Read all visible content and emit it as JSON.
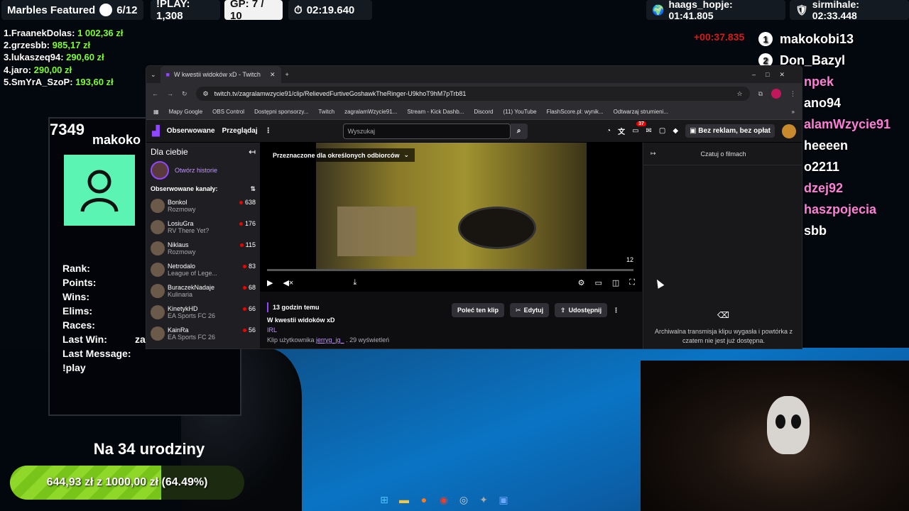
{
  "hud": {
    "marbles": "Marbles Featured",
    "marbles_count": "6/12",
    "play": "!PLAY: 1,308",
    "gp": "GP: 7 / 10",
    "timer": "02:19.640",
    "record1": "haags_hopje: 01:41.805",
    "record2": "sirmihale: 02:33.448",
    "red_timer": "+00:37.835"
  },
  "top_donors": [
    {
      "name": "1.FraanekDolas:",
      "value": "1 002,36 zł"
    },
    {
      "name": "2.grzesbb:",
      "value": "985,17 zł"
    },
    {
      "name": "3.lukaszeq94:",
      "value": "290,60 zł"
    },
    {
      "name": "4.jaro:",
      "value": "290,00 zł"
    },
    {
      "name": "5.SmYrA_SzoP:",
      "value": "193,60 zł"
    }
  ],
  "leaderboard": [
    {
      "rank": "1",
      "name": "makokobi13"
    },
    {
      "rank": "2",
      "name": "Don_Bazyl"
    },
    {
      "rank": "",
      "name": "npek"
    },
    {
      "rank": "",
      "name": "ano94"
    },
    {
      "rank": "",
      "name": "alamWzycie91"
    },
    {
      "rank": "",
      "name": "heeeen"
    },
    {
      "rank": "",
      "name": "o2211"
    },
    {
      "rank": "",
      "name": "dzej92"
    },
    {
      "rank": "",
      "name": "haszpojecia"
    },
    {
      "rank": "",
      "name": "sbb"
    }
  ],
  "panel": {
    "number": "7349",
    "name": "makoko",
    "stats": [
      "Rank:",
      "Points:",
      "Wins:",
      "Elims:",
      "Races:",
      "Last Win:",
      "Last Message:",
      "!play"
    ],
    "last_win_value": "za"
  },
  "goal": {
    "title": "Na 34 urodziny",
    "current": "644,93 zł",
    "sep": "z",
    "target": "1000,00 zł",
    "percent_label": "(64.49%)",
    "fraction": 0.6449
  },
  "browser": {
    "tab_title": "W kwestii widoków xD - Twitch",
    "url": "twitch.tv/zagralamwzycie91/clip/RelievedFurtiveGoshawkTheRinger-U9khoT9hM7pTrb81",
    "bookmarks": [
      "Mapy Google",
      "OBS Control",
      "Dostępni sponsorzy...",
      "Twitch",
      "zagralamWzycie91...",
      "Stream - Kick Dashb...",
      "Discord",
      "(11) YouTube",
      "FlashScore.pl: wynik...",
      "Odtwarzaj strumieni..."
    ]
  },
  "twitch": {
    "nav_following": "Obserwowane",
    "nav_browse": "Przeglądaj",
    "search_placeholder": "Wyszukaj",
    "notif_count": "37",
    "ad_free": "Bez reklam, bez opłat",
    "for_you": "Dla ciebie",
    "open_stories": "Otwórz historie",
    "followed": "Obserwowane kanały:",
    "channels": [
      {
        "name": "Bonkol",
        "game": "Rozmowy",
        "viewers": "638"
      },
      {
        "name": "LosiuGra",
        "game": "RV There Yet?",
        "viewers": "176"
      },
      {
        "name": "Niklaus",
        "game": "Rozmowy",
        "viewers": "115"
      },
      {
        "name": "Netrodalo",
        "game": "League of Lege...",
        "viewers": "83"
      },
      {
        "name": "BuraczekNadaje",
        "game": "Kulinaria",
        "viewers": "68"
      },
      {
        "name": "KinetykHD",
        "game": "EA Sports FC 26",
        "viewers": "66"
      },
      {
        "name": "KainRa",
        "game": "EA Sports FC 26",
        "viewers": "56"
      }
    ],
    "audience_badge": "Przeznaczone dla określonych odbiorców",
    "video_count": "12",
    "time_ago": "13 godzin temu",
    "clip_title": "W kwestii widoków xD",
    "category": "IRL",
    "clip_by": "Klip użytkownika",
    "clip_author": "jerryg_jg_",
    "views": " . 29 wyświetleń",
    "recommend": "Poleć ten klip",
    "edit": "Edytuj",
    "share": "Udostępnij",
    "chat_title": "Czatuj o filmach",
    "chat_msg": "Archiwalna transmisja klipu wygasła i powtórka z czatem nie jest już dostępna."
  }
}
